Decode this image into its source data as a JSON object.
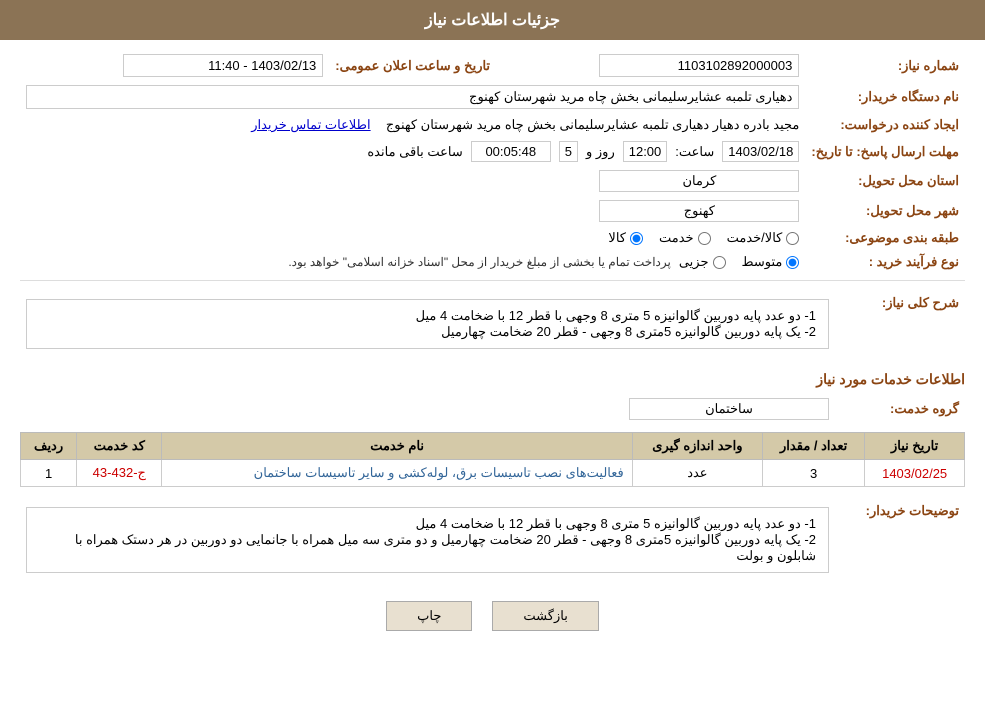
{
  "header": {
    "title": "جزئیات اطلاعات نیاز"
  },
  "fields": {
    "shomareNiaz_label": "شماره نیاز:",
    "shomareNiaz_value": "1103102892000003",
    "namDastgah_label": "نام دستگاه خریدار:",
    "namDastgah_value": "دهیاری تلمبه عشایرسلیمانی بخش چاه مرید شهرستان کهنوج",
    "ijadKonande_label": "ایجاد کننده درخواست:",
    "ijadKonande_value": "مجید بادره دهیار دهیاری تلمبه عشایرسلیمانی بخش چاه مرید شهرستان کهنوج",
    "ettelaat_link": "اطلاعات تماس خریدار",
    "mohlat_label": "مهلت ارسال پاسخ: تا تاریخ:",
    "tarikh_date": "1403/02/18",
    "tarikh_saat_label": "ساعت:",
    "tarikh_saat": "12:00",
    "tarikh_roz_label": "روز و",
    "tarikh_roz": "5",
    "tarikh_maande_label": "ساعت باقی مانده",
    "tarikh_maande": "00:05:48",
    "ostan_label": "استان محل تحویل:",
    "ostan_value": "کرمان",
    "shahr_label": "شهر محل تحویل:",
    "shahr_value": "کهنوج",
    "tabaqe_label": "طبقه بندی موضوعی:",
    "tabaqe_options": [
      "کالا",
      "خدمت",
      "کالا/خدمت"
    ],
    "tabaqe_selected": "کالا",
    "noeFarayand_label": "نوع فرآیند خرید :",
    "noeFarayand_options": [
      "جزیی",
      "متوسط"
    ],
    "noeFarayand_selected": "متوسط",
    "noeFarayand_note": "پرداخت تمام یا بخشی از مبلغ خریدار از محل \"اسناد خزانه اسلامی\" خواهد بود.",
    "tarikhElan_label": "تاریخ و ساعت اعلان عمومی:",
    "tarikhElan_value": "1403/02/13 - 11:40",
    "sharhKoli_title": "شرح کلی نیاز:",
    "sharhKoli_line1": "1- دو عدد پایه دوربین گالوانیزه 5 متری 8 وجهی با قطر 12 با ضخامت 4 میل",
    "sharhKoli_line2": "2- یک پایه دوربین گالوانیزه 5متری 8 وجهی - قطر 20 ضخامت چهارمیل",
    "khadamatTitle": "اطلاعات خدمات مورد نیاز",
    "groupKhadamat_label": "گروه خدمت:",
    "groupKhadamat_value": "ساختمان",
    "table": {
      "headers": [
        "ردیف",
        "کد خدمت",
        "نام خدمت",
        "واحد اندازه گیری",
        "تعداد / مقدار",
        "تاریخ نیاز"
      ],
      "rows": [
        {
          "radif": "1",
          "kodKhadamat": "ج-432-43",
          "namKhadamat": "فعالیت‌های نصب تاسیسات برق، لوله‌کشی و سایر تاسیسات ساختمان",
          "vahed": "عدد",
          "tedad": "3",
          "tarikh": "1403/02/25"
        }
      ]
    },
    "tosifKharidar_label": "توضیحات خریدار:",
    "tosifKharidar_line1": "1- دو عدد پایه دوربین گالوانیزه 5 متری 8 وجهی با قطر 12 با ضخامت 4 میل",
    "tosifKharidar_line2": "2- یک پایه دوربین گالوانیزه 5متری 8 وجهی - قطر 20 ضخامت چهارمیل و دو متری سه میل همراه با جانمایی دو دوربین در هر دستک همراه با شابلون و بولت",
    "buttons": {
      "chap": "چاپ",
      "bazgasht": "بازگشت"
    }
  }
}
